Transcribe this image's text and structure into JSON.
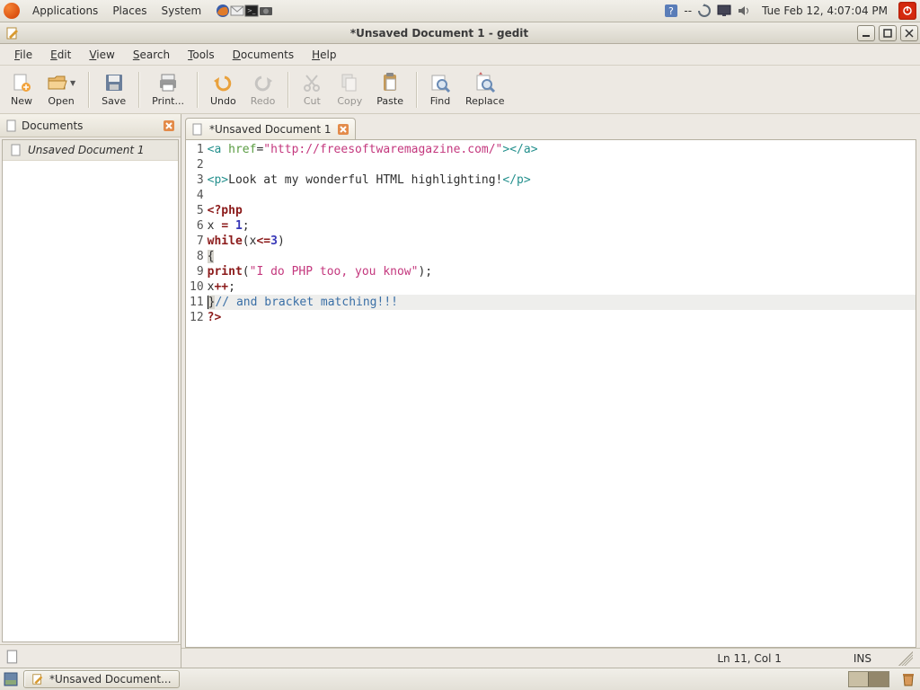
{
  "gnome": {
    "menus": [
      "Applications",
      "Places",
      "System"
    ],
    "battery": "--",
    "clock": "Tue Feb 12,  4:07:04 PM"
  },
  "window": {
    "title": "*Unsaved Document 1 - gedit"
  },
  "menubar": [
    {
      "label": "File",
      "u": 0
    },
    {
      "label": "Edit",
      "u": 0
    },
    {
      "label": "View",
      "u": 0
    },
    {
      "label": "Search",
      "u": 0
    },
    {
      "label": "Tools",
      "u": 0
    },
    {
      "label": "Documents",
      "u": 0
    },
    {
      "label": "Help",
      "u": 0
    }
  ],
  "toolbar": {
    "new": "New",
    "open": "Open",
    "save": "Save",
    "print": "Print...",
    "undo": "Undo",
    "redo": "Redo",
    "cut": "Cut",
    "copy": "Copy",
    "paste": "Paste",
    "find": "Find",
    "replace": "Replace"
  },
  "sidepanel": {
    "title": "Documents",
    "items": [
      "Unsaved Document 1"
    ]
  },
  "tab": {
    "label": "*Unsaved Document 1"
  },
  "code_lines": 12,
  "status": {
    "pos": "Ln 11, Col 1",
    "mode": "INS"
  },
  "taskbar": {
    "btn": "*Unsaved Document..."
  }
}
